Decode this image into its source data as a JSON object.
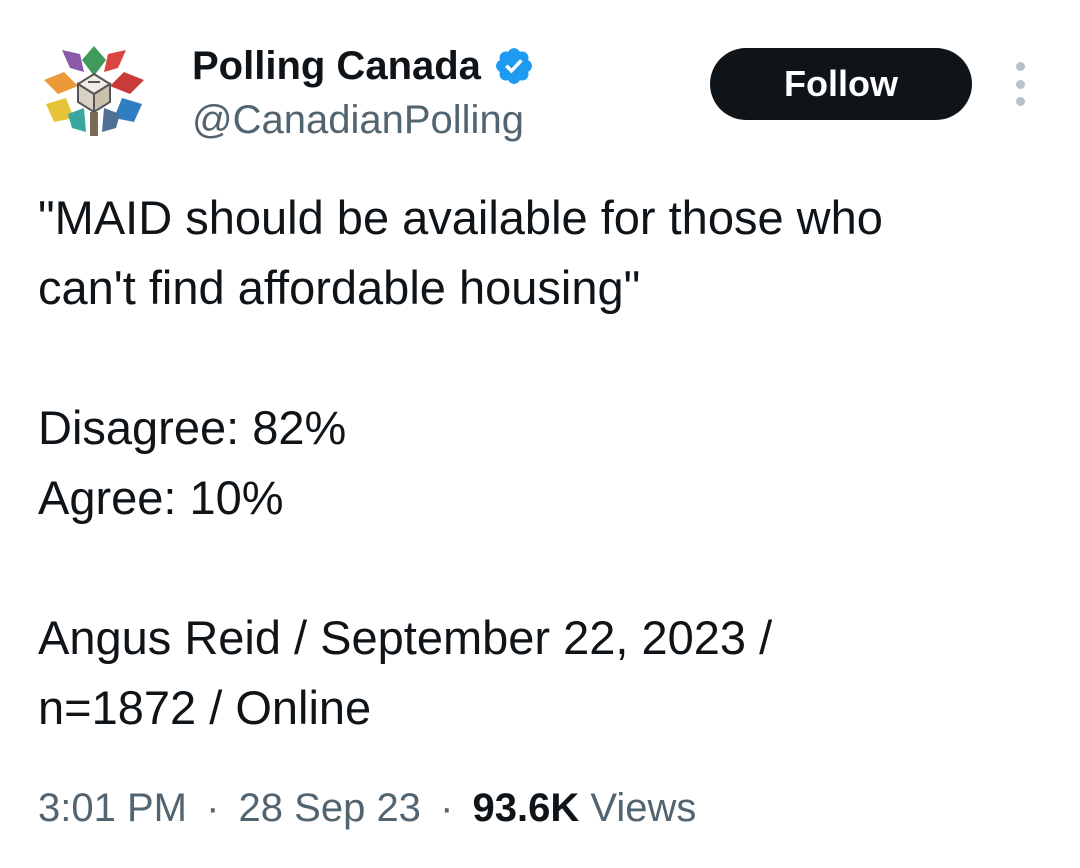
{
  "author": {
    "name": "Polling Canada",
    "handle": "@CanadianPolling",
    "verified": true
  },
  "actions": {
    "follow_label": "Follow"
  },
  "tweet": {
    "lines": [
      "\"MAID should be available for those who",
      "can't find affordable housing\"",
      "Disagree: 82%",
      "Agree: 10%",
      "Angus Reid / September 22, 2023 /",
      "n=1872 / Online"
    ]
  },
  "meta": {
    "time": "3:01 PM",
    "date": "28 Sep 23",
    "separator": "·",
    "views_count": "93.6K",
    "views_label": "Views"
  },
  "colors": {
    "text_primary": "#0f1419",
    "text_secondary": "#536471",
    "verified_blue": "#1d9bf0",
    "follow_bg": "#0f1419"
  },
  "icons": {
    "avatar": "polling-canada-logo",
    "verified": "verified-badge-icon",
    "more": "more-options-icon"
  }
}
